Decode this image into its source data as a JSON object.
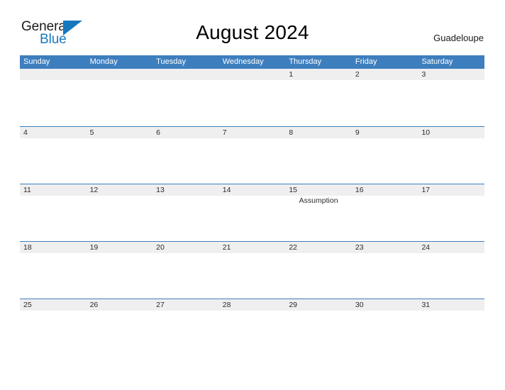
{
  "brand": {
    "word_one": "General",
    "word_two": "Blue",
    "flag_icon": "blue-triangle-flag-icon",
    "color_dark": "#1a1a1a",
    "color_blue": "#1878be"
  },
  "header": {
    "title": "August 2024",
    "region": "Guadeloupe"
  },
  "theme": {
    "header_blue": "#3d7ebe",
    "date_band_gray": "#efefef",
    "text_dark": "#2b2b2b",
    "page_background": "#ffffff"
  },
  "calendar": {
    "month": "August",
    "year": "2024",
    "weekday_headers": [
      "Sunday",
      "Monday",
      "Tuesday",
      "Wednesday",
      "Thursday",
      "Friday",
      "Saturday"
    ],
    "weeks": [
      [
        {
          "date": "",
          "events": []
        },
        {
          "date": "",
          "events": []
        },
        {
          "date": "",
          "events": []
        },
        {
          "date": "",
          "events": []
        },
        {
          "date": "1",
          "events": []
        },
        {
          "date": "2",
          "events": []
        },
        {
          "date": "3",
          "events": []
        }
      ],
      [
        {
          "date": "4",
          "events": []
        },
        {
          "date": "5",
          "events": []
        },
        {
          "date": "6",
          "events": []
        },
        {
          "date": "7",
          "events": []
        },
        {
          "date": "8",
          "events": []
        },
        {
          "date": "9",
          "events": []
        },
        {
          "date": "10",
          "events": []
        }
      ],
      [
        {
          "date": "11",
          "events": []
        },
        {
          "date": "12",
          "events": []
        },
        {
          "date": "13",
          "events": []
        },
        {
          "date": "14",
          "events": []
        },
        {
          "date": "15",
          "events": [
            "Assumption"
          ]
        },
        {
          "date": "16",
          "events": []
        },
        {
          "date": "17",
          "events": []
        }
      ],
      [
        {
          "date": "18",
          "events": []
        },
        {
          "date": "19",
          "events": []
        },
        {
          "date": "20",
          "events": []
        },
        {
          "date": "21",
          "events": []
        },
        {
          "date": "22",
          "events": []
        },
        {
          "date": "23",
          "events": []
        },
        {
          "date": "24",
          "events": []
        }
      ],
      [
        {
          "date": "25",
          "events": []
        },
        {
          "date": "26",
          "events": []
        },
        {
          "date": "27",
          "events": []
        },
        {
          "date": "28",
          "events": []
        },
        {
          "date": "29",
          "events": []
        },
        {
          "date": "30",
          "events": []
        },
        {
          "date": "31",
          "events": []
        }
      ]
    ]
  }
}
